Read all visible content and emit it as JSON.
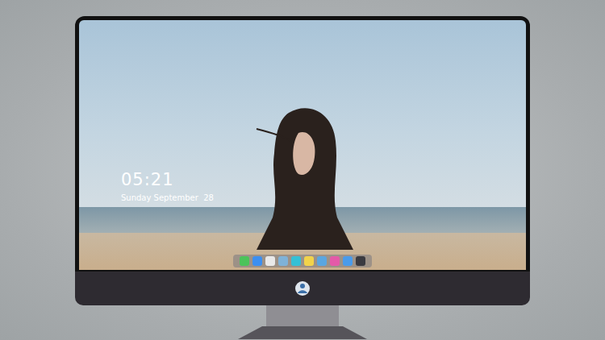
{
  "clock": {
    "time": "05:21",
    "date": "Sunday September  28"
  },
  "dock": {
    "apps": [
      {
        "color": "#4cc35a"
      },
      {
        "color": "#3d8ff0"
      },
      {
        "color": "#e9e9e9"
      },
      {
        "color": "#7fb2d8"
      },
      {
        "color": "#35c0d6"
      },
      {
        "color": "#f2d34a"
      },
      {
        "color": "#5aa6e0"
      },
      {
        "color": "#e45aa8"
      },
      {
        "color": "#4a9bea"
      },
      {
        "color": "#3a3a40"
      }
    ]
  }
}
